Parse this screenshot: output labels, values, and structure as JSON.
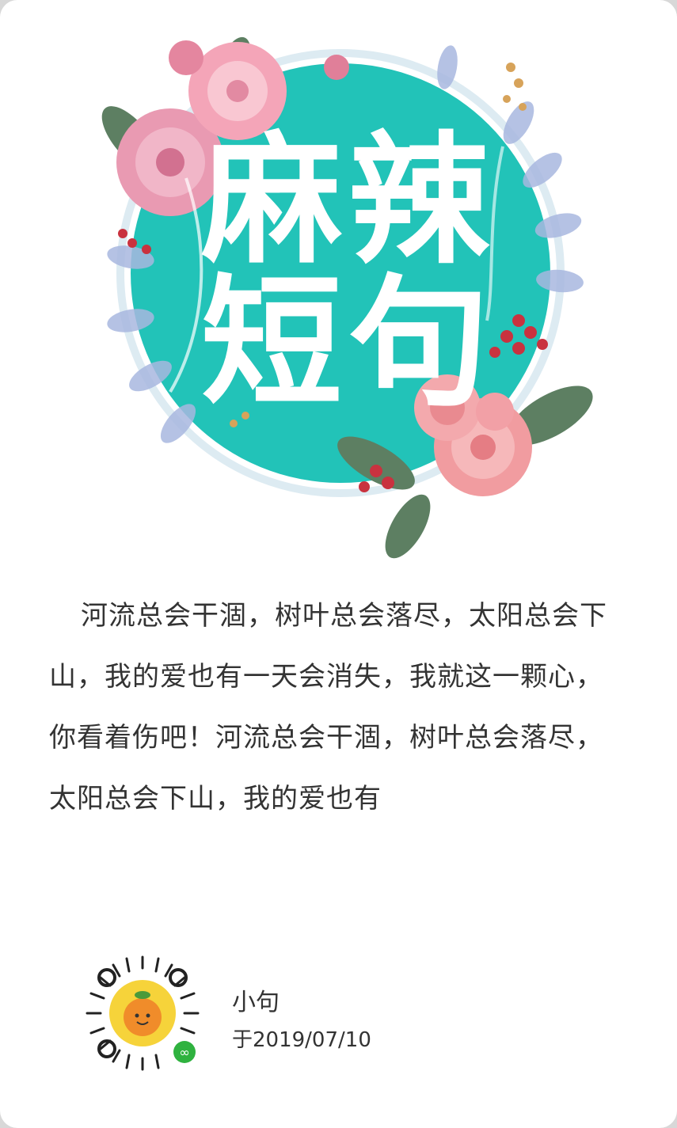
{
  "cover": {
    "title_line1": "麻辣",
    "title_line2": "短句",
    "circle_color": "#22c3b8",
    "icons": [
      "floral-wreath-illustration"
    ]
  },
  "quote": {
    "text": "河流总会干涸，树叶总会落尽，太阳总会下山，我的爱也有一天会消失，我就这一颗心，你看着伤吧！河流总会干涸，树叶总会落尽，太阳总会下山，我的爱也有"
  },
  "footer": {
    "author": "小句",
    "date": "于2019/07/10",
    "qr_icon": "mini-program-code-icon",
    "mascot_icon": "orange-mascot-icon"
  }
}
